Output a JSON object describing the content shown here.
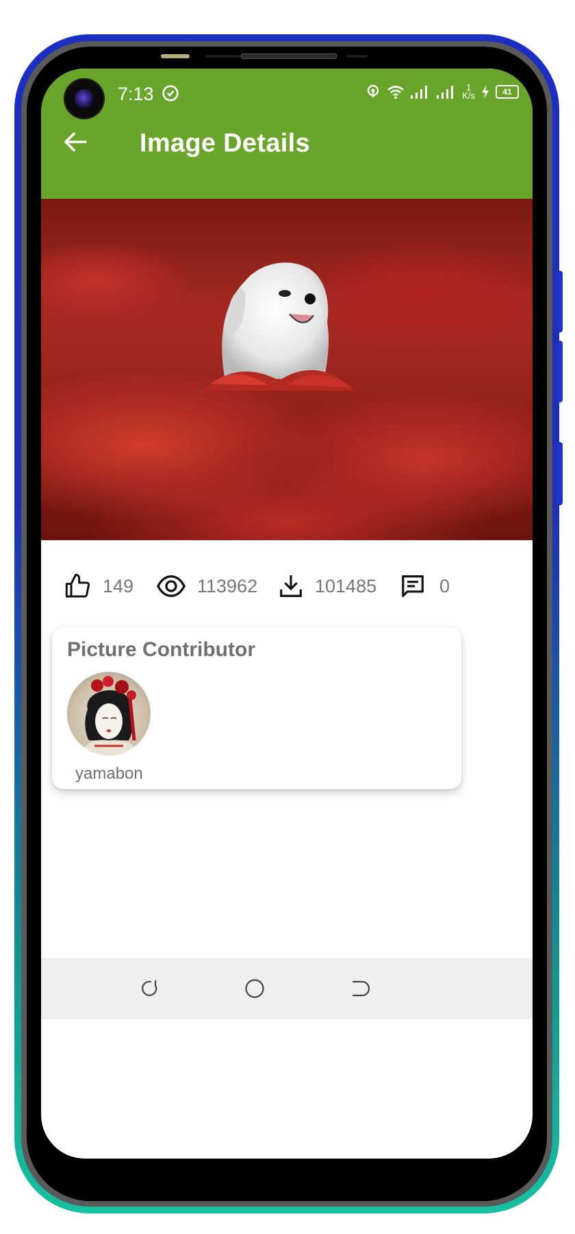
{
  "status_bar": {
    "time": "7:13",
    "network_speed_value": "1",
    "network_speed_unit": "K/s",
    "battery": "41"
  },
  "app_bar": {
    "title": "Image Details"
  },
  "stats": {
    "likes": "149",
    "views": "113962",
    "downloads": "101485",
    "comments": "0"
  },
  "contributor": {
    "heading": "Picture Contributor",
    "name": "yamabon"
  },
  "colors": {
    "app_bar": "#6aa52b",
    "icon": "#111111",
    "stat_text": "#757575"
  },
  "icons": [
    "back-arrow-icon",
    "like-icon",
    "eye-icon",
    "download-icon",
    "comment-icon",
    "recent-apps-icon",
    "home-icon",
    "back-nav-icon"
  ]
}
